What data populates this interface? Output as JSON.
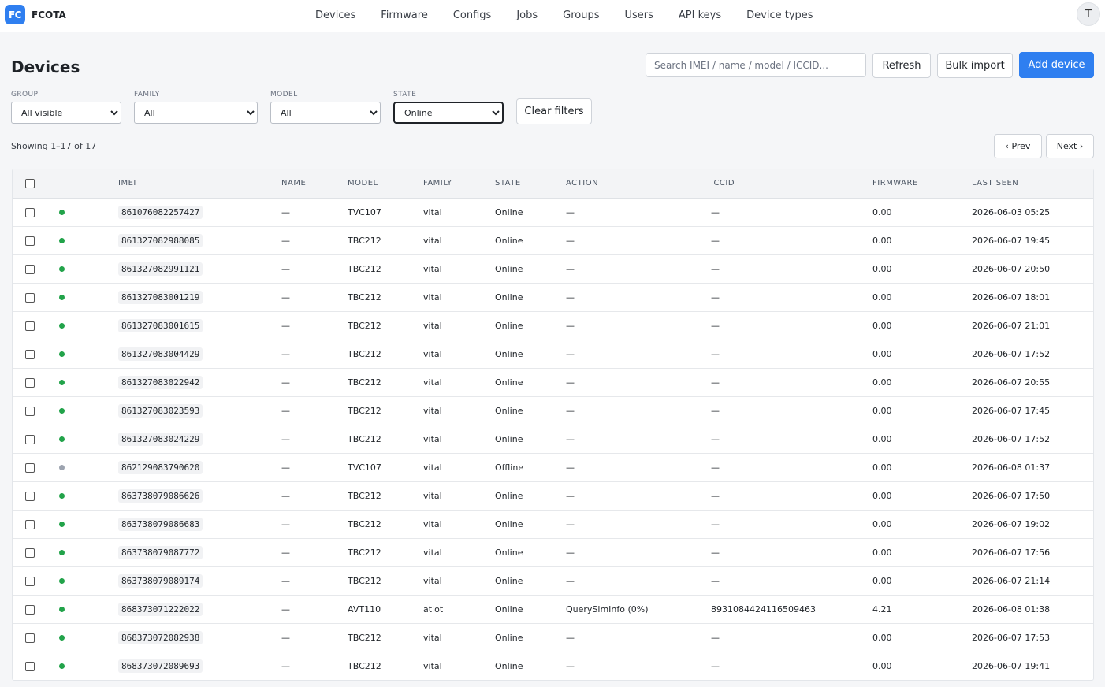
{
  "app": {
    "logo_text": "FC",
    "brand": "FCOTA",
    "user_initial": "T"
  },
  "nav": [
    "Devices",
    "Firmware",
    "Configs",
    "Jobs",
    "Groups",
    "Users",
    "API keys",
    "Device types"
  ],
  "page": {
    "title": "Devices"
  },
  "search": {
    "placeholder": "Search IMEI / name / model / ICCID..."
  },
  "toolbar": {
    "refresh": "Refresh",
    "bulk_import": "Bulk import",
    "add_device": "Add device"
  },
  "filters": {
    "group": {
      "label": "GROUP",
      "value": "All visible"
    },
    "family": {
      "label": "FAMILY",
      "value": "All"
    },
    "model": {
      "label": "MODEL",
      "value": "All"
    },
    "state": {
      "label": "STATE",
      "value": "Online"
    },
    "clear": "Clear filters"
  },
  "pager": {
    "showing": "Showing 1–17 of 17",
    "prev": "‹ Prev",
    "next": "Next ›"
  },
  "colors": {
    "online": "#22a34a",
    "offline": "#9ca3af",
    "accent": "#2f7ff0"
  },
  "table": {
    "columns": [
      "",
      "",
      "IMEI",
      "NAME",
      "MODEL",
      "FAMILY",
      "STATE",
      "ACTION",
      "ICCID",
      "FIRMWARE",
      "LAST SEEN"
    ],
    "rows": [
      {
        "status": "online",
        "imei": "861076082257427",
        "name": "—",
        "model": "TVC107",
        "family": "vital",
        "state": "Online",
        "action": "—",
        "iccid": "—",
        "firmware": "0.00",
        "last_seen": "2026-06-03 05:25"
      },
      {
        "status": "online",
        "imei": "861327082988085",
        "name": "—",
        "model": "TBC212",
        "family": "vital",
        "state": "Online",
        "action": "—",
        "iccid": "—",
        "firmware": "0.00",
        "last_seen": "2026-06-07 19:45"
      },
      {
        "status": "online",
        "imei": "861327082991121",
        "name": "—",
        "model": "TBC212",
        "family": "vital",
        "state": "Online",
        "action": "—",
        "iccid": "—",
        "firmware": "0.00",
        "last_seen": "2026-06-07 20:50"
      },
      {
        "status": "online",
        "imei": "861327083001219",
        "name": "—",
        "model": "TBC212",
        "family": "vital",
        "state": "Online",
        "action": "—",
        "iccid": "—",
        "firmware": "0.00",
        "last_seen": "2026-06-07 18:01"
      },
      {
        "status": "online",
        "imei": "861327083001615",
        "name": "—",
        "model": "TBC212",
        "family": "vital",
        "state": "Online",
        "action": "—",
        "iccid": "—",
        "firmware": "0.00",
        "last_seen": "2026-06-07 21:01"
      },
      {
        "status": "online",
        "imei": "861327083004429",
        "name": "—",
        "model": "TBC212",
        "family": "vital",
        "state": "Online",
        "action": "—",
        "iccid": "—",
        "firmware": "0.00",
        "last_seen": "2026-06-07 17:52"
      },
      {
        "status": "online",
        "imei": "861327083022942",
        "name": "—",
        "model": "TBC212",
        "family": "vital",
        "state": "Online",
        "action": "—",
        "iccid": "—",
        "firmware": "0.00",
        "last_seen": "2026-06-07 20:55"
      },
      {
        "status": "online",
        "imei": "861327083023593",
        "name": "—",
        "model": "TBC212",
        "family": "vital",
        "state": "Online",
        "action": "—",
        "iccid": "—",
        "firmware": "0.00",
        "last_seen": "2026-06-07 17:45"
      },
      {
        "status": "online",
        "imei": "861327083024229",
        "name": "—",
        "model": "TBC212",
        "family": "vital",
        "state": "Online",
        "action": "—",
        "iccid": "—",
        "firmware": "0.00",
        "last_seen": "2026-06-07 17:52"
      },
      {
        "status": "offline",
        "imei": "862129083790620",
        "name": "—",
        "model": "TVC107",
        "family": "vital",
        "state": "Offline",
        "action": "—",
        "iccid": "—",
        "firmware": "0.00",
        "last_seen": "2026-06-08 01:37"
      },
      {
        "status": "online",
        "imei": "863738079086626",
        "name": "—",
        "model": "TBC212",
        "family": "vital",
        "state": "Online",
        "action": "—",
        "iccid": "—",
        "firmware": "0.00",
        "last_seen": "2026-06-07 17:50"
      },
      {
        "status": "online",
        "imei": "863738079086683",
        "name": "—",
        "model": "TBC212",
        "family": "vital",
        "state": "Online",
        "action": "—",
        "iccid": "—",
        "firmware": "0.00",
        "last_seen": "2026-06-07 19:02"
      },
      {
        "status": "online",
        "imei": "863738079087772",
        "name": "—",
        "model": "TBC212",
        "family": "vital",
        "state": "Online",
        "action": "—",
        "iccid": "—",
        "firmware": "0.00",
        "last_seen": "2026-06-07 17:56"
      },
      {
        "status": "online",
        "imei": "863738079089174",
        "name": "—",
        "model": "TBC212",
        "family": "vital",
        "state": "Online",
        "action": "—",
        "iccid": "—",
        "firmware": "0.00",
        "last_seen": "2026-06-07 21:14"
      },
      {
        "status": "online",
        "imei": "868373071222022",
        "name": "—",
        "model": "AVT110",
        "family": "atiot",
        "state": "Online",
        "action": "QuerySimInfo (0%)",
        "iccid": "8931084424116509463",
        "firmware": "4.21",
        "last_seen": "2026-06-08 01:38"
      },
      {
        "status": "online",
        "imei": "868373072082938",
        "name": "—",
        "model": "TBC212",
        "family": "vital",
        "state": "Online",
        "action": "—",
        "iccid": "—",
        "firmware": "0.00",
        "last_seen": "2026-06-07 17:53"
      },
      {
        "status": "online",
        "imei": "868373072089693",
        "name": "—",
        "model": "TBC212",
        "family": "vital",
        "state": "Online",
        "action": "—",
        "iccid": "—",
        "firmware": "0.00",
        "last_seen": "2026-06-07 19:41"
      }
    ]
  }
}
